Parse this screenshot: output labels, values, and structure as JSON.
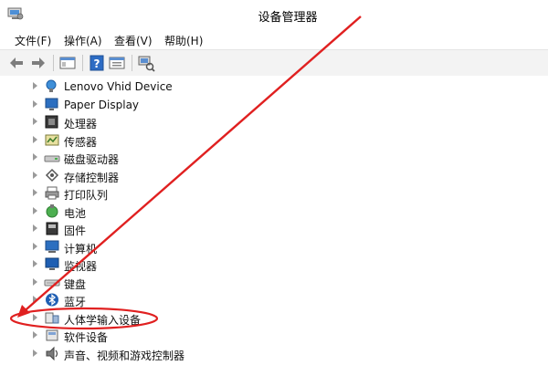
{
  "window": {
    "title": "设备管理器",
    "icon": "device-manager-icon"
  },
  "menu": [
    {
      "label": "文件(F)"
    },
    {
      "label": "操作(A)"
    },
    {
      "label": "查看(V)"
    },
    {
      "label": "帮助(H)"
    }
  ],
  "toolbar": [
    {
      "icon": "back-arrow-icon"
    },
    {
      "icon": "forward-arrow-icon"
    },
    {
      "icon": "show-hide-console-tree-icon"
    },
    {
      "icon": "help-icon"
    },
    {
      "icon": "properties-icon"
    },
    {
      "icon": "scan-hardware-icon"
    }
  ],
  "tree": {
    "items": [
      {
        "label": "Lenovo Vhid Device",
        "icon": "hid-device-icon"
      },
      {
        "label": "Paper Display",
        "icon": "display-icon"
      },
      {
        "label": "处理器",
        "icon": "processor-icon"
      },
      {
        "label": "传感器",
        "icon": "sensor-icon"
      },
      {
        "label": "磁盘驱动器",
        "icon": "disk-drive-icon"
      },
      {
        "label": "存储控制器",
        "icon": "storage-controller-icon"
      },
      {
        "label": "打印队列",
        "icon": "printer-icon"
      },
      {
        "label": "电池",
        "icon": "battery-icon"
      },
      {
        "label": "固件",
        "icon": "firmware-icon"
      },
      {
        "label": "计算机",
        "icon": "computer-icon"
      },
      {
        "label": "监视器",
        "icon": "monitor-icon"
      },
      {
        "label": "键盘",
        "icon": "keyboard-icon"
      },
      {
        "label": "蓝牙",
        "icon": "bluetooth-icon"
      },
      {
        "label": "人体学输入设备",
        "icon": "human-interface-device-icon"
      },
      {
        "label": "软件设备",
        "icon": "software-device-icon"
      },
      {
        "label": "声音、视频和游戏控制器",
        "icon": "audio-icon"
      }
    ]
  },
  "annotation": {
    "color": "#e02020",
    "highlighted_item": "人体学输入设备"
  }
}
